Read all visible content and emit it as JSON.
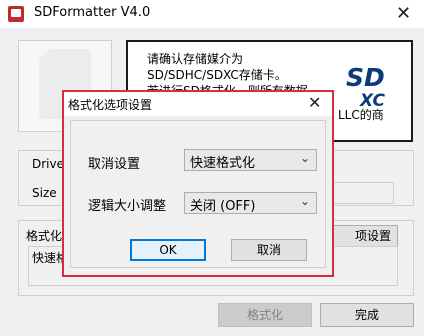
{
  "window": {
    "title": "SDFormatter V4.0",
    "close_glyph": "✕"
  },
  "info": {
    "line1": "请确认存储媒介为",
    "line2": "SD/SDHC/SDXC存储卡。",
    "line3": "若进行SD格式化，则所有数据",
    "line4": "LLC的商"
  },
  "logo": {
    "letters_top": "SD",
    "letters_bottom": "XC",
    "color": "#0d3a7a"
  },
  "drive": {
    "drive_label": "Drive",
    "size_label": "Size"
  },
  "format_group": {
    "label": "格式化",
    "options_button": "项设置",
    "current_text": "快速格"
  },
  "buttons": {
    "format": "格式化",
    "done": "完成"
  },
  "dialog": {
    "title": "格式化选项设置",
    "close_glyph": "✕",
    "cancel_setting_label": "取消设置",
    "cancel_setting_value": "快速格式化",
    "logic_size_label": "逻辑大小调整",
    "logic_size_value": "关闭 (OFF)",
    "ok": "OK",
    "cancel": "取消",
    "arrow_glyph": "⌄"
  },
  "colors": {
    "dialog_border": "#d42f3a",
    "ok_border": "#0078d7",
    "disabled_text": "#838383"
  }
}
